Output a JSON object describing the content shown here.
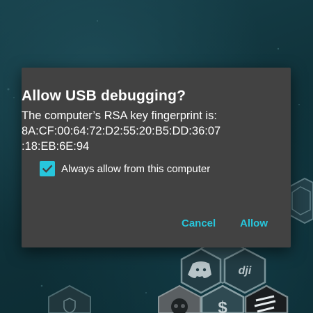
{
  "dialog": {
    "title": "Allow USB debugging?",
    "message_line1": "The computer’s RSA key fingerprint is:",
    "fingerprint_line1": "8A:CF:00:64:72:D2:55:20:B5:DD:36:07",
    "fingerprint_line2": ":18:EB:6E:94",
    "checkbox_label": "Always allow from this computer",
    "checkbox_checked": true,
    "cancel_label": "Cancel",
    "allow_label": "Allow"
  },
  "colors": {
    "accent": "#27c6dc",
    "dialog_bg": "#424242",
    "wallpaper": "#0f3139"
  },
  "wallpaper_icons": [
    "hexagon-icon",
    "hexagon-icon",
    "discord-icon",
    "dji-icon",
    "shield-icon",
    "skull-icon",
    "dollar-icon",
    "stripes-icon"
  ]
}
